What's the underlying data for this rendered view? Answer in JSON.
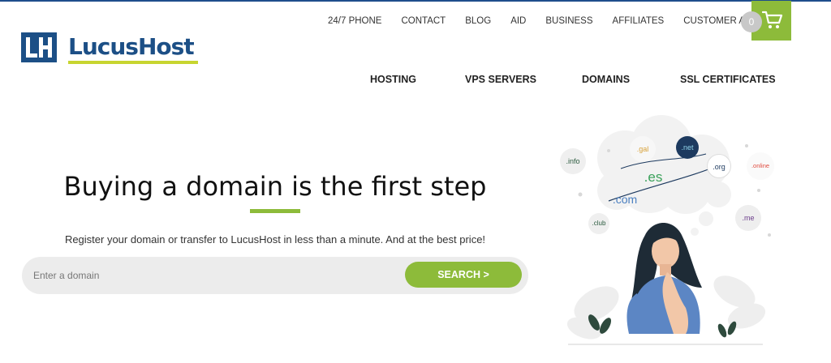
{
  "brand": {
    "name": "LucusHost",
    "mark": "LH",
    "primary_color": "#1c4f86",
    "accent_color": "#8dbb3a"
  },
  "top_nav": [
    {
      "label": "24/7 PHONE"
    },
    {
      "label": "CONTACT"
    },
    {
      "label": "BLOG"
    },
    {
      "label": "AID"
    },
    {
      "label": "BUSINESS"
    },
    {
      "label": "AFFILIATES"
    },
    {
      "label": "CUSTOMER AREA"
    }
  ],
  "cart": {
    "count": "0",
    "icon": "cart-icon"
  },
  "main_nav": [
    {
      "label": "HOSTING"
    },
    {
      "label": "VPS SERVERS"
    },
    {
      "label": "DOMAINS"
    },
    {
      "label": "SSL CERTIFICATES"
    }
  ],
  "hero": {
    "title": "Buying a domain is the first step",
    "subtitle": "Register your domain or transfer to LucusHost in less than a minute. And at the best price!",
    "search_placeholder": "Enter a domain",
    "search_button": "SEARCH  >"
  },
  "illustration": {
    "tlds": [
      ".info",
      ".gal",
      ".net",
      ".org",
      ".online",
      ".es",
      ".com",
      ".club",
      ".me"
    ]
  }
}
